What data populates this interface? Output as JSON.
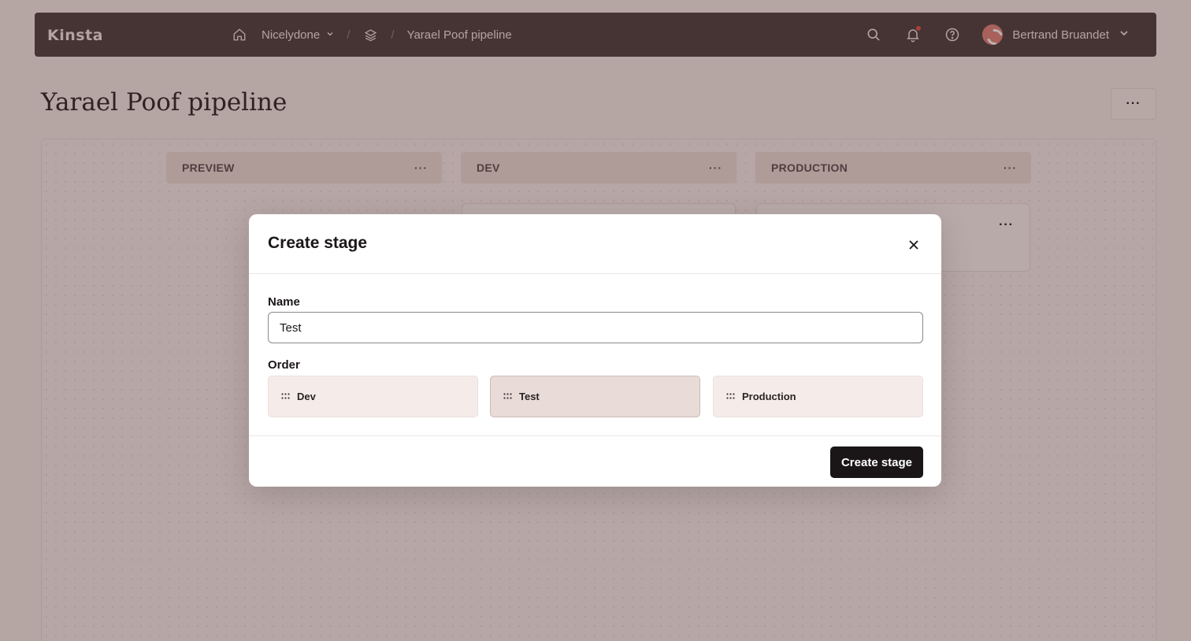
{
  "app": {
    "logo": "Kinsta"
  },
  "breadcrumb": {
    "company": "Nicelydone",
    "separator": "/",
    "pipeline": "Yarael Poof pipeline"
  },
  "user": {
    "name": "Bertrand Bruandet"
  },
  "page": {
    "title": "Yarael Poof pipeline",
    "more_label": "···"
  },
  "columns": [
    {
      "label": "PREVIEW",
      "more_label": "···"
    },
    {
      "label": "DEV",
      "more_label": "···"
    },
    {
      "label": "PRODUCTION",
      "more_label": "···"
    }
  ],
  "card": {
    "more_label": "···"
  },
  "modal": {
    "title": "Create stage",
    "name_label": "Name",
    "name_value": "Test",
    "order_label": "Order",
    "order_items": [
      "Dev",
      "Test",
      "Production"
    ],
    "active_order_item": "Test",
    "submit_label": "Create stage"
  },
  "icons": {
    "home": "home-icon",
    "chevron": "chevron-down-icon",
    "layers": "layers-icon",
    "search": "search-icon",
    "bell": "bell-icon",
    "help": "help-icon",
    "close": "close-icon",
    "grip": "drag-handle-icon"
  },
  "colors": {
    "nav_bg": "#4a3f40",
    "primary_button": "#1a1617",
    "notification_dot": "#e0514b"
  }
}
